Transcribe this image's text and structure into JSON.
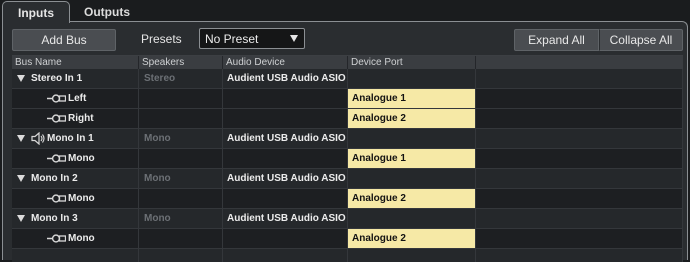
{
  "tabs": [
    {
      "label": "Inputs"
    },
    {
      "label": "Outputs"
    }
  ],
  "toolbar": {
    "add_bus_label": "Add Bus",
    "presets_label": "Presets",
    "preset_value": "No Preset",
    "expand_all_label": "Expand All",
    "collapse_all_label": "Collapse All"
  },
  "columns": [
    "Bus Name",
    "Speakers",
    "Audio Device",
    "Device Port"
  ],
  "rows": [
    {
      "name": "Stereo In 1",
      "speakers": "Stereo",
      "device": "Audient USB Audio ASIO Dri",
      "port": ""
    },
    {
      "name": "Left",
      "speakers": "",
      "device": "",
      "port": "Analogue 1"
    },
    {
      "name": "Right",
      "speakers": "",
      "device": "",
      "port": "Analogue 2"
    },
    {
      "name": "Mono In 1",
      "speakers": "Mono",
      "device": "Audient USB Audio ASIO Dri",
      "port": ""
    },
    {
      "name": "Mono",
      "speakers": "",
      "device": "",
      "port": "Analogue 1"
    },
    {
      "name": "Mono In 2",
      "speakers": "Mono",
      "device": "Audient USB Audio ASIO Dri",
      "port": ""
    },
    {
      "name": "Mono",
      "speakers": "",
      "device": "",
      "port": "Analogue 2"
    },
    {
      "name": "Mono In 3",
      "speakers": "Mono",
      "device": "Audient USB Audio ASIO Dri",
      "port": ""
    },
    {
      "name": "Mono",
      "speakers": "",
      "device": "",
      "port": "Analogue 2"
    }
  ],
  "icons": {
    "expand": "triangle-down-icon",
    "speaker": "speaker-icon",
    "channel": "channel-plug-icon"
  },
  "colors": {
    "port_highlight": "#f6e9a6",
    "panel": "#2a2d30",
    "button": "#4a4d51"
  }
}
